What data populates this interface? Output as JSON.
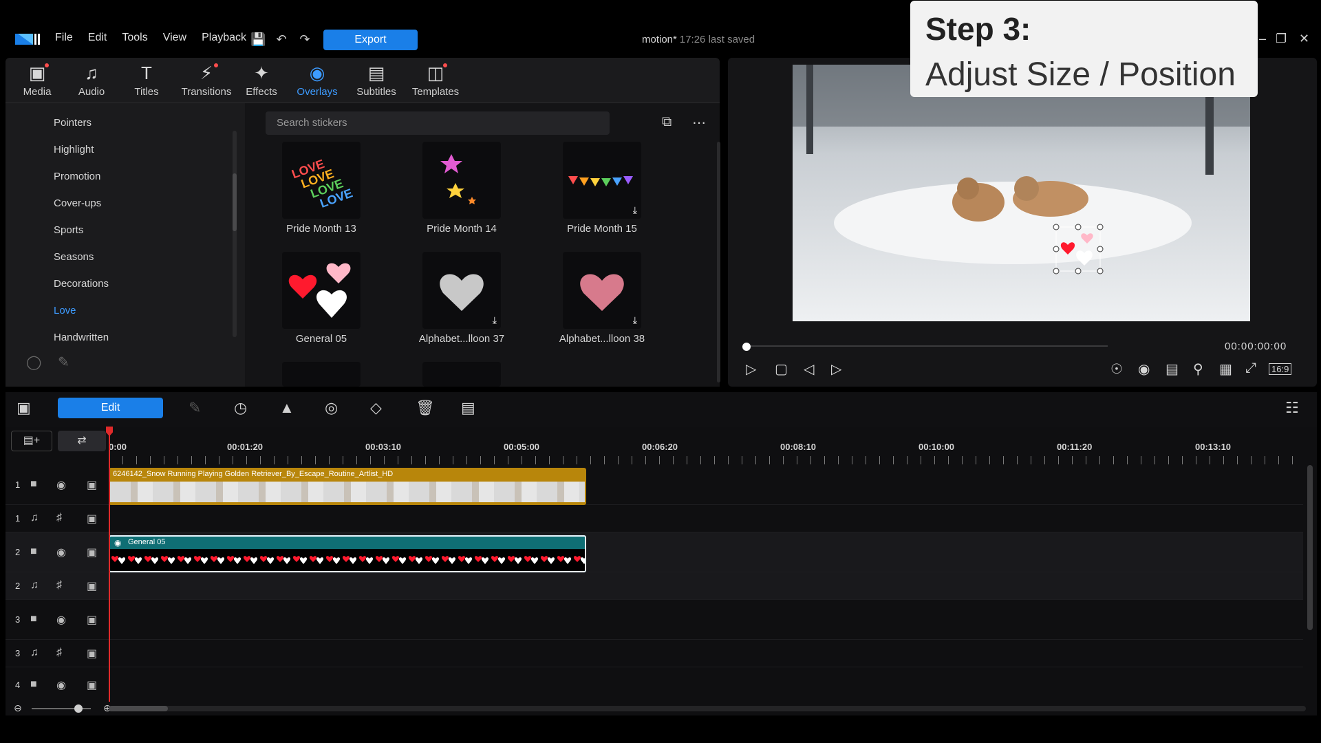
{
  "app": {
    "menu": [
      "File",
      "Edit",
      "Tools",
      "View",
      "Playback"
    ],
    "export_label": "Export",
    "doc_name": "motion*",
    "saved_status": "17:26 last saved"
  },
  "step_card": {
    "heading": "Step 3:",
    "subtitle": "Adjust Size / Position"
  },
  "library": {
    "tabs": [
      {
        "label": "Media",
        "icon": "media-icon",
        "dot": true
      },
      {
        "label": "Audio",
        "icon": "music-icon",
        "dot": false
      },
      {
        "label": "Titles",
        "icon": "titles-icon",
        "dot": false
      },
      {
        "label": "Transitions",
        "icon": "transitions-icon",
        "dot": true
      },
      {
        "label": "Effects",
        "icon": "effects-icon",
        "dot": false
      },
      {
        "label": "Overlays",
        "icon": "overlays-icon",
        "dot": false,
        "active": true
      },
      {
        "label": "Subtitles",
        "icon": "subtitles-icon",
        "dot": false
      },
      {
        "label": "Templates",
        "icon": "templates-icon",
        "dot": true
      }
    ],
    "categories": [
      "Pointers",
      "Highlight",
      "Promotion",
      "Cover-ups",
      "Sports",
      "Seasons",
      "Decorations",
      "Love",
      "Handwritten"
    ],
    "active_category": "Love",
    "search_placeholder": "Search stickers",
    "stickers": [
      {
        "name": "Pride Month 13",
        "download": false
      },
      {
        "name": "Pride Month 14",
        "download": false
      },
      {
        "name": "Pride Month 15",
        "download": true
      },
      {
        "name": "General 05",
        "download": false
      },
      {
        "name": "Alphabet...lloon 37",
        "download": true
      },
      {
        "name": "Alphabet...lloon 38",
        "download": true
      }
    ]
  },
  "preview": {
    "timecode": "00:00:00:00",
    "aspect": "16:9"
  },
  "timeline": {
    "edit_label": "Edit",
    "ruler": [
      "0:00",
      "00:01:20",
      "00:03:10",
      "00:05:00",
      "00:06:20",
      "00:08:10",
      "00:10:00",
      "00:11:20",
      "00:13:10"
    ],
    "tracks": [
      "1",
      "1",
      "2",
      "2",
      "3",
      "3",
      "4"
    ],
    "video_clip": "6246142_Snow Running Playing Golden Retriever_By_Escape_Routine_Artlist_HD",
    "overlay_clip": "General 05"
  },
  "colors": {
    "accent": "#1a7fe8",
    "active_tab": "#3d9bff",
    "video_clip": "#b8860b",
    "overlay_clip": "#0f6e74",
    "playhead": "#e02a2a"
  }
}
